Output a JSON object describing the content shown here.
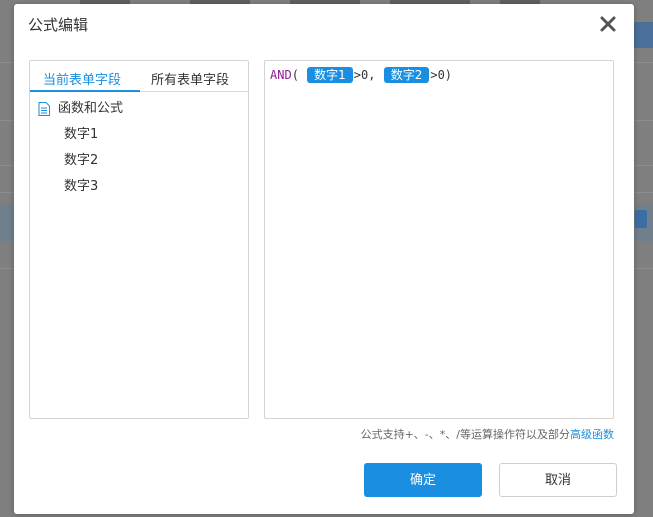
{
  "dialog": {
    "title": "公式编辑",
    "close_icon": "close-icon"
  },
  "left_panel": {
    "tabs": [
      {
        "label": "当前表单字段",
        "active": true
      },
      {
        "label": "所有表单字段",
        "active": false
      }
    ],
    "tree": {
      "root": {
        "label": "函数和公式",
        "icon": "document-icon"
      },
      "children": [
        {
          "label": "数字1"
        },
        {
          "label": "数字2"
        },
        {
          "label": "数字3"
        }
      ]
    }
  },
  "editor": {
    "formula": {
      "function": "AND",
      "open": "(",
      "field1": "数字1",
      "op1": ">0,",
      "field2": "数字2",
      "op2": ">0)"
    }
  },
  "hint": {
    "text": "公式支持+、-、*、/等运算操作符以及部分",
    "link": "高级函数"
  },
  "buttons": {
    "ok": "确定",
    "cancel": "取消"
  },
  "colors": {
    "accent": "#1a8ee0",
    "keyword": "#8b1d8b",
    "overlay": "#7f7f7f"
  }
}
